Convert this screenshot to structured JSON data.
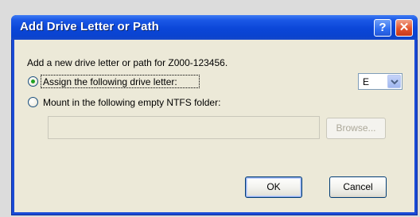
{
  "window": {
    "title": "Add Drive Letter or Path",
    "help_glyph": "?",
    "close_glyph": "✕"
  },
  "dialog": {
    "description": "Add a new drive letter or path for Z000-123456.",
    "option_assign": {
      "label": "Assign the following drive letter:",
      "selected": true
    },
    "drive_letter": {
      "value": "E"
    },
    "option_mount": {
      "label": "Mount in the following empty NTFS folder:",
      "selected": false
    },
    "folder_path": {
      "value": ""
    },
    "browse_label": "Browse...",
    "ok_label": "OK",
    "cancel_label": "Cancel"
  },
  "icons": {
    "help": "help-icon",
    "close": "close-icon",
    "dropdown": "chevron-down-icon"
  },
  "colors": {
    "titlebar": "#0b46d8",
    "dialog_bg": "#ece9d8",
    "radio_dot": "#21a121",
    "close_button": "#e2542c"
  }
}
